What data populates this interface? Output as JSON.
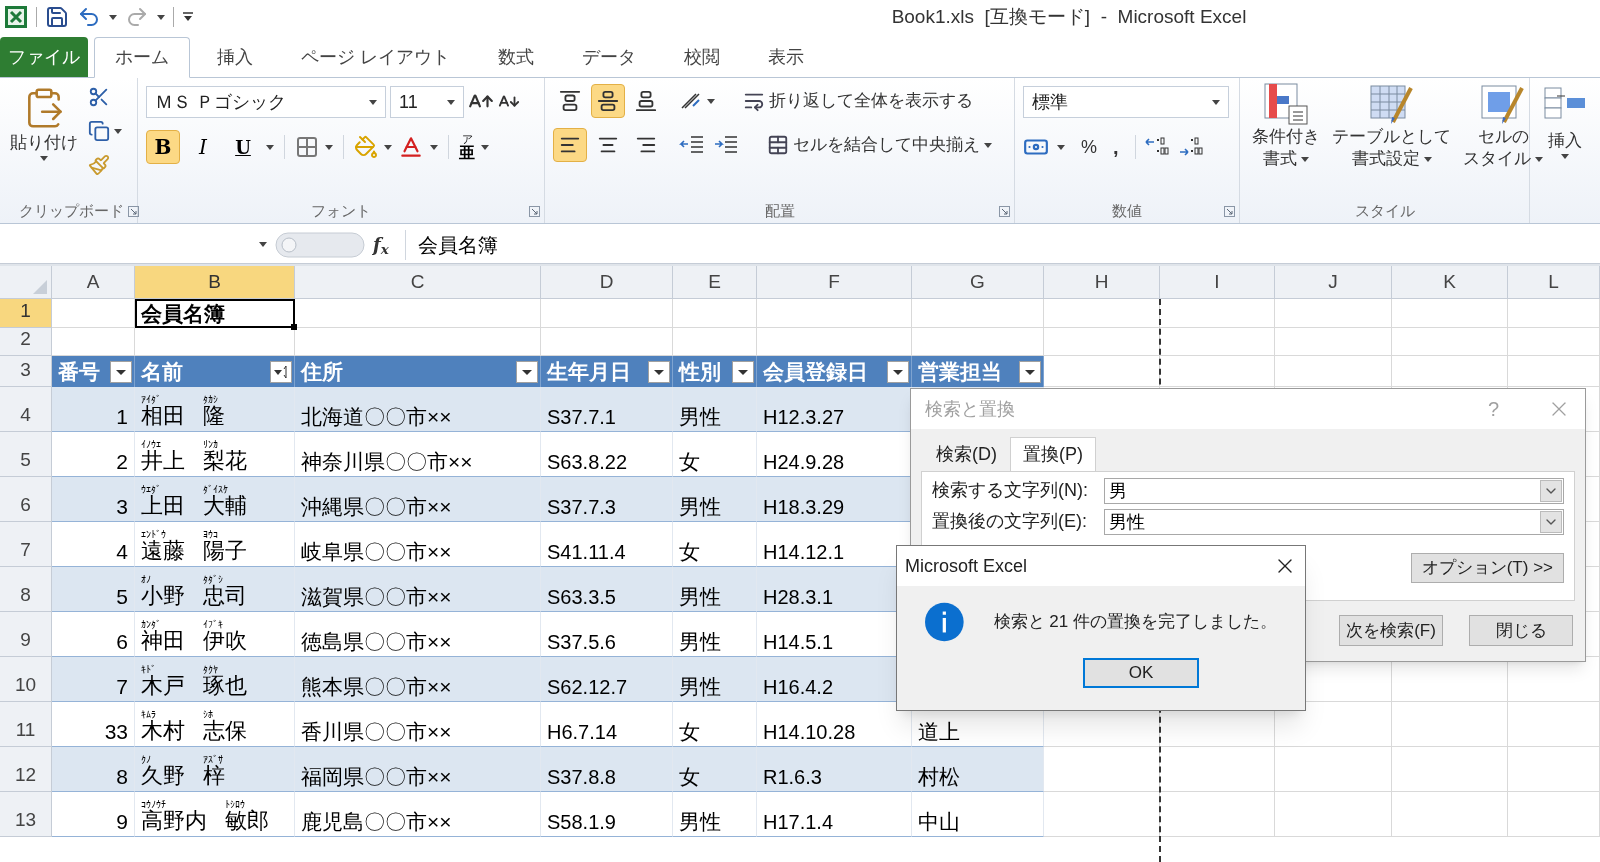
{
  "title": "Book1.xls  [互換モード]  -  Microsoft Excel",
  "ribbon_tabs": [
    {
      "label": "ファイル",
      "kind": "file",
      "selected": false
    },
    {
      "label": "ホーム",
      "kind": "tab",
      "selected": true
    },
    {
      "label": "挿入",
      "kind": "tab",
      "selected": false
    },
    {
      "label": "ページ レイアウト",
      "kind": "tab",
      "selected": false
    },
    {
      "label": "数式",
      "kind": "tab",
      "selected": false
    },
    {
      "label": "データ",
      "kind": "tab",
      "selected": false
    },
    {
      "label": "校閲",
      "kind": "tab",
      "selected": false
    },
    {
      "label": "表示",
      "kind": "tab",
      "selected": false
    }
  ],
  "clipboard": {
    "paste": "貼り付け",
    "group": "クリップボード"
  },
  "font": {
    "name": "ＭＳ Ｐゴシック",
    "size": "11",
    "bold": {
      "label": "B",
      "on": true
    },
    "italic": {
      "label": "I",
      "on": false
    },
    "underline": {
      "label": "U",
      "on": false
    },
    "phonetic": {
      "ruby": "ア",
      "base": "亜"
    },
    "group": "フォント"
  },
  "alignment": {
    "vertical": [
      {
        "kind": "top",
        "selected": false
      },
      {
        "kind": "middle",
        "selected": true
      },
      {
        "kind": "bottom",
        "selected": false
      }
    ],
    "horizontal": [
      {
        "kind": "left",
        "selected": true
      },
      {
        "kind": "center",
        "selected": false
      },
      {
        "kind": "right",
        "selected": false
      }
    ],
    "wrap": "折り返して全体を表示する",
    "merge": "セルを結合して中央揃え",
    "group": "配置"
  },
  "number": {
    "format": "標準",
    "percent": "%",
    "comma": ",",
    "group": "数値"
  },
  "styles": {
    "buttons": [
      {
        "kind": "conditional",
        "lines": [
          "条件付き",
          "書式"
        ]
      },
      {
        "kind": "table",
        "lines": [
          "テーブルとして",
          "書式設定"
        ]
      },
      {
        "kind": "cell",
        "lines": [
          "セルの",
          "スタイル"
        ]
      }
    ],
    "group": "スタイル"
  },
  "cells": {
    "insert": "挿入"
  },
  "formula_bar": {
    "fx": "f$_{x}$",
    "value": "会員名簿"
  },
  "sheet": {
    "columns": [
      {
        "label": "A",
        "selected": false
      },
      {
        "label": "B",
        "selected": true
      },
      {
        "label": "C",
        "selected": false
      },
      {
        "label": "D",
        "selected": false
      },
      {
        "label": "E",
        "selected": false
      },
      {
        "label": "F",
        "selected": false
      },
      {
        "label": "G",
        "selected": false
      },
      {
        "label": "H",
        "selected": false
      },
      {
        "label": "I",
        "selected": false
      },
      {
        "label": "J",
        "selected": false
      },
      {
        "label": "K",
        "selected": false
      },
      {
        "label": "L",
        "selected": false
      }
    ],
    "row_headers": [
      {
        "label": "1",
        "selected": true
      },
      {
        "label": "2",
        "selected": false
      },
      {
        "label": "3",
        "selected": false
      },
      {
        "label": "4",
        "selected": false
      },
      {
        "label": "5",
        "selected": false
      },
      {
        "label": "6",
        "selected": false
      },
      {
        "label": "7",
        "selected": false
      },
      {
        "label": "8",
        "selected": false
      },
      {
        "label": "9",
        "selected": false
      },
      {
        "label": "10",
        "selected": false
      },
      {
        "label": "11",
        "selected": false
      },
      {
        "label": "12",
        "selected": false
      },
      {
        "label": "13",
        "selected": false
      }
    ],
    "title_cell": "会員名簿"
  },
  "table": {
    "headers": [
      {
        "label": "番号",
        "kind": "dropdown"
      },
      {
        "label": "名前",
        "kind": "sorted"
      },
      {
        "label": "住所",
        "kind": "dropdown"
      },
      {
        "label": "生年月日",
        "kind": "dropdown"
      },
      {
        "label": "性別",
        "kind": "dropdown"
      },
      {
        "label": "会員登録日",
        "kind": "dropdown"
      },
      {
        "label": "営業担当",
        "kind": "dropdown"
      }
    ],
    "rows": [
      {
        "no": "1",
        "surname_kana": "ｱｲﾀﾞ",
        "surname": "相田",
        "given_kana": "ﾀｶｼ",
        "given": "隆",
        "address": "北海道〇〇市××",
        "birth": "S37.7.1",
        "sex": "男性",
        "joined": "H12.3.27"
      },
      {
        "no": "2",
        "surname_kana": "ｲﾉｳｴ",
        "surname": "井上",
        "given_kana": "ﾘﾝｶ",
        "given": "梨花",
        "address": "神奈川県〇〇市××",
        "birth": "S63.8.22",
        "sex": "女",
        "joined": "H24.9.28"
      },
      {
        "no": "3",
        "surname_kana": "ｳｴﾀﾞ",
        "surname": "上田",
        "given_kana": "ﾀﾞｲｽｹ",
        "given": "大輔",
        "address": "沖縄県〇〇市××",
        "birth": "S37.7.3",
        "sex": "男性",
        "joined": "H18.3.29"
      },
      {
        "no": "4",
        "surname_kana": "ｴﾝﾄﾞｳ",
        "surname": "遠藤",
        "given_kana": "ﾖｳｺ",
        "given": "陽子",
        "address": "岐阜県〇〇市××",
        "birth": "S41.11.4",
        "sex": "女",
        "joined": "H14.12.1"
      },
      {
        "no": "5",
        "surname_kana": "ｵﾉ",
        "surname": "小野",
        "given_kana": "ﾀﾀﾞｼ",
        "given": "忠司",
        "address": "滋賀県〇〇市××",
        "birth": "S63.3.5",
        "sex": "男性",
        "joined": "H28.3.1"
      },
      {
        "no": "6",
        "surname_kana": "ｶﾝﾀﾞ",
        "surname": "神田",
        "given_kana": "ｲﾌﾞｷ",
        "given": "伊吹",
        "address": "徳島県〇〇市××",
        "birth": "S37.5.6",
        "sex": "男性",
        "joined": "H14.5.1"
      },
      {
        "no": "7",
        "surname_kana": "ｷﾄﾞ",
        "surname": "木戸",
        "given_kana": "ﾀｸﾔ",
        "given": "琢也",
        "address": "熊本県〇〇市××",
        "birth": "S62.12.7",
        "sex": "男性",
        "joined": "H16.4.2"
      },
      {
        "no": "33",
        "surname_kana": "ｷﾑﾗ",
        "surname": "木村",
        "given_kana": "ｼﾎ",
        "given": "志保",
        "address": "香川県〇〇市××",
        "birth": "H6.7.14",
        "sex": "女",
        "joined": "H14.10.28",
        "staff": "道上"
      },
      {
        "no": "8",
        "surname_kana": "ｸﾉ",
        "surname": "久野",
        "given_kana": "ｱｽﾞｻ",
        "given": "梓",
        "address": "福岡県〇〇市××",
        "birth": "S37.8.8",
        "sex": "女",
        "joined": "R1.6.3",
        "staff": "村松"
      },
      {
        "no": "9",
        "surname_kana": "ｺｳﾉｳﾁ",
        "surname": "高野内",
        "given_kana": "ﾄｼﾛｳ",
        "given": "敏郎",
        "address": "鹿児島〇〇市××",
        "birth": "S58.1.9",
        "sex": "男性",
        "joined": "H17.1.4",
        "staff": "中山"
      }
    ]
  },
  "find_dialog": {
    "title": "検索と置換",
    "help": "?",
    "tabs": [
      {
        "label": "検索(D)",
        "selected": false
      },
      {
        "label": "置換(P)",
        "selected": true
      }
    ],
    "fields": [
      {
        "label": "検索する文字列(N):",
        "value": "男"
      },
      {
        "label": "置換後の文字列(E):",
        "value": "男性"
      }
    ],
    "options": "オプション(T) >>",
    "buttons": [
      "次を検索(F)",
      "閉じる"
    ]
  },
  "message_box": {
    "title": "Microsoft Excel",
    "message": "検索と 21 件の置換を完了しました。",
    "ok": "OK"
  }
}
